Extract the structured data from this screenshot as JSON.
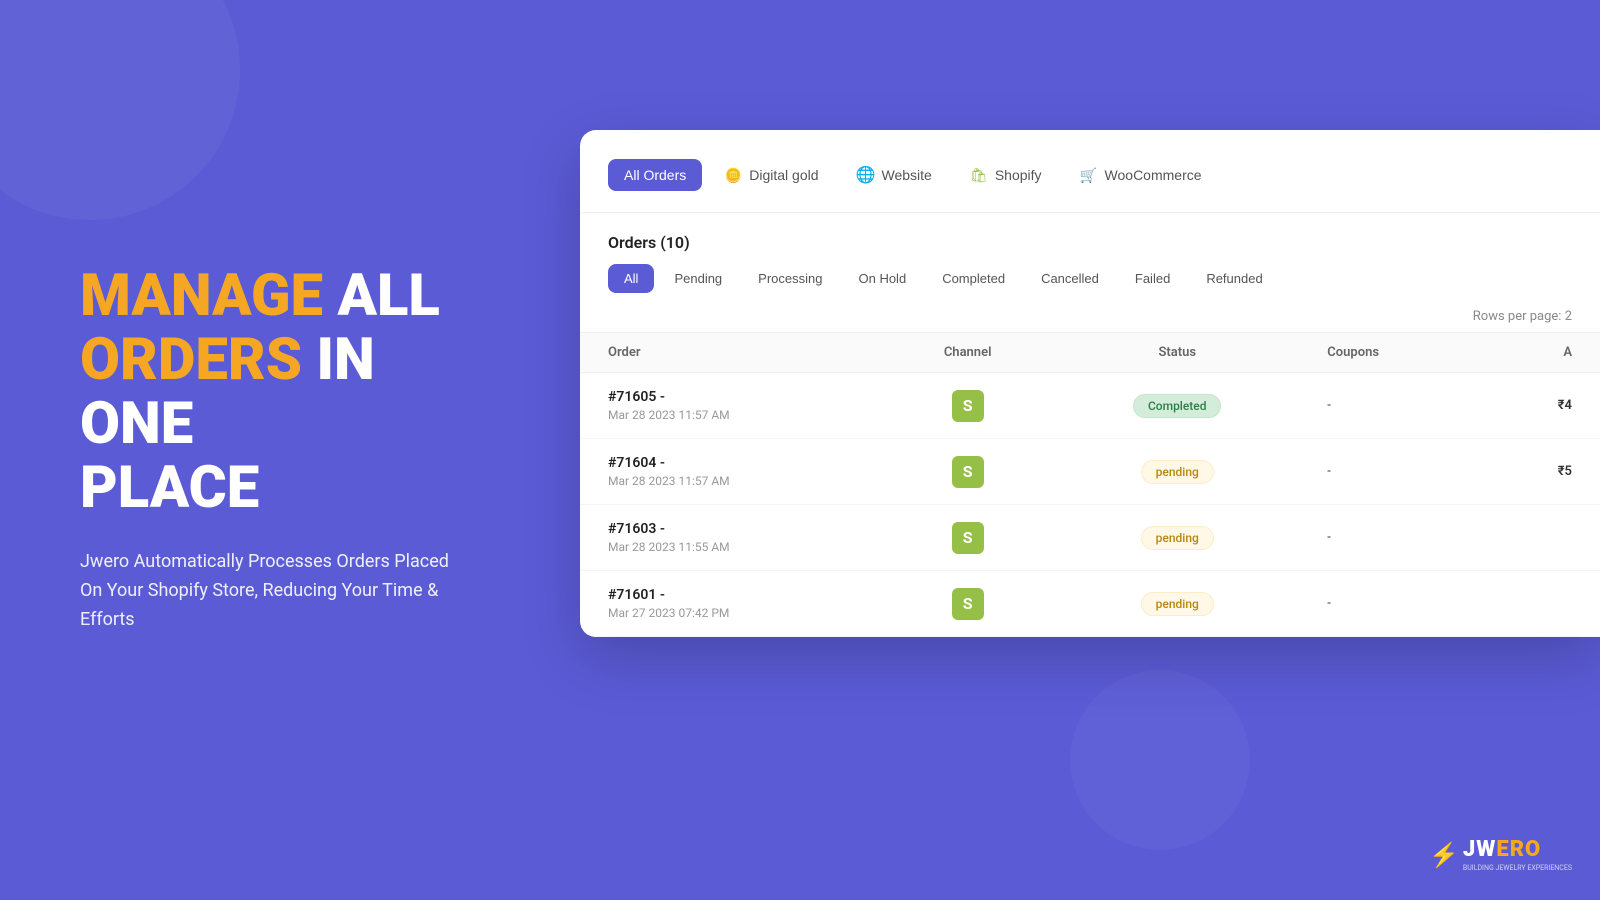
{
  "background": {
    "color": "#5b5bd6"
  },
  "hero": {
    "title_line1_orange": "MANAGE",
    "title_line1_white": " ALL",
    "title_line2_orange": "ORDERS",
    "title_line2_white": " IN ONE",
    "title_line3_white": "PLACE",
    "subtitle": "Jwero Automatically Processes Orders Placed On Your Shopify Store, Reducing Your Time & Efforts"
  },
  "card": {
    "channel_tabs": [
      {
        "id": "all-orders",
        "label": "All Orders",
        "active": true,
        "icon": null
      },
      {
        "id": "digital-gold",
        "label": "Digital gold",
        "active": false,
        "icon": "🪙"
      },
      {
        "id": "website",
        "label": "Website",
        "active": false,
        "icon": "🌐"
      },
      {
        "id": "shopify",
        "label": "Shopify",
        "active": false,
        "icon": "🛍"
      },
      {
        "id": "woocommerce",
        "label": "WooCommerce",
        "active": false,
        "icon": "🛒"
      }
    ],
    "orders_title": "Orders (10)",
    "status_tabs": [
      {
        "id": "all",
        "label": "All",
        "active": true
      },
      {
        "id": "pending",
        "label": "Pending",
        "active": false
      },
      {
        "id": "processing",
        "label": "Processing",
        "active": false
      },
      {
        "id": "on-hold",
        "label": "On Hold",
        "active": false
      },
      {
        "id": "completed",
        "label": "Completed",
        "active": false
      },
      {
        "id": "cancelled",
        "label": "Cancelled",
        "active": false
      },
      {
        "id": "failed",
        "label": "Failed",
        "active": false
      },
      {
        "id": "refunded",
        "label": "Refunded",
        "active": false
      }
    ],
    "rows_per_page_label": "Rows per page:",
    "rows_per_page_value": "2",
    "table": {
      "columns": [
        {
          "id": "order",
          "label": "Order"
        },
        {
          "id": "channel",
          "label": "Channel"
        },
        {
          "id": "status",
          "label": "Status"
        },
        {
          "id": "coupons",
          "label": "Coupons"
        },
        {
          "id": "amount",
          "label": "A"
        }
      ],
      "rows": [
        {
          "id": "#71605 -",
          "date": "Mar 28 2023 11:57 AM",
          "channel": "shopify",
          "status": "Completed",
          "status_type": "completed",
          "coupons": "",
          "amount": "₹4"
        },
        {
          "id": "#71604 -",
          "date": "Mar 28 2023 11:57 AM",
          "channel": "shopify",
          "status": "pending",
          "status_type": "pending",
          "coupons": "",
          "amount": "₹5"
        },
        {
          "id": "#71603 -",
          "date": "Mar 28 2023 11:55 AM",
          "channel": "shopify",
          "status": "pending",
          "status_type": "pending",
          "coupons": "",
          "amount": ""
        },
        {
          "id": "#71601 -",
          "date": "Mar 27 2023 07:42 PM",
          "channel": "shopify",
          "status": "pending",
          "status_type": "pending",
          "coupons": "",
          "amount": ""
        }
      ]
    }
  },
  "logo": {
    "lightning": "⚡",
    "text_white": "JW",
    "text_orange": "ERO",
    "tagline": "BUILDING JEWELRY EXPERIENCES"
  }
}
